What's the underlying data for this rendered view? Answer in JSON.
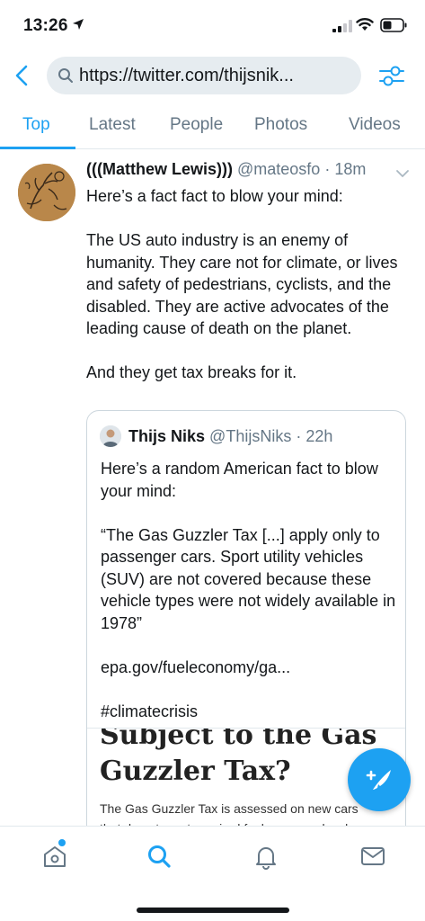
{
  "status_bar": {
    "time": "13:26",
    "icons": [
      "location-arrow-icon",
      "signal-icon",
      "wifi-icon",
      "battery-icon"
    ]
  },
  "search_bar": {
    "url": "https://twitter.com/thijsnik...",
    "icons": [
      "back-icon",
      "search-icon",
      "filter-icon"
    ]
  },
  "tabs": [
    {
      "label": "Top",
      "active": true
    },
    {
      "label": "Latest",
      "active": false
    },
    {
      "label": "People",
      "active": false
    },
    {
      "label": "Photos",
      "active": false
    },
    {
      "label": "Videos",
      "active": false
    }
  ],
  "tweet": {
    "author_name": "(((Matthew Lewis)))",
    "handle": "@mateosfo",
    "time": "18m",
    "separator": " · ",
    "paragraphs": [
      "Here’s a fact fact to blow your mind:",
      "The US auto industry is an enemy of humanity. They care not for climate, or lives and safety of pedestrians, cyclists, and the disabled. They are active advocates of the leading cause of death on the planet.",
      "And they get tax breaks for it."
    ],
    "quote": {
      "author_name": "Thijs Niks",
      "handle": "@ThijsNiks",
      "time": "22h",
      "paragraphs": [
        "Here’s a random American fact to blow your mind:",
        "“The Gas Guzzler Tax [...] apply only to passenger cars. Sport utility vehicles (SUV) are not covered because these vehicle types were not widely available in 1978”",
        "epa.gov/fueleconomy/ga...",
        "#climatecrisis"
      ],
      "image": {
        "heading_line1": "Subject to the Gas",
        "heading_line2": "Guzzler Tax?",
        "body_line1": "The Gas Guzzler Tax is assessed on new cars",
        "body_line2": "that do not meet required fuel economy levels."
      }
    }
  },
  "fab": {
    "icon": "compose-tweet-icon"
  },
  "bottom_nav": [
    {
      "icon": "home-icon",
      "active": false,
      "notification": true
    },
    {
      "icon": "search-icon",
      "active": true,
      "notification": false
    },
    {
      "icon": "bell-icon",
      "active": false,
      "notification": false
    },
    {
      "icon": "mail-icon",
      "active": false,
      "notification": false
    }
  ],
  "colors": {
    "accent": "#1da1f2",
    "text": "#14171a",
    "muted": "#657786",
    "divider": "#e1e8ed"
  }
}
